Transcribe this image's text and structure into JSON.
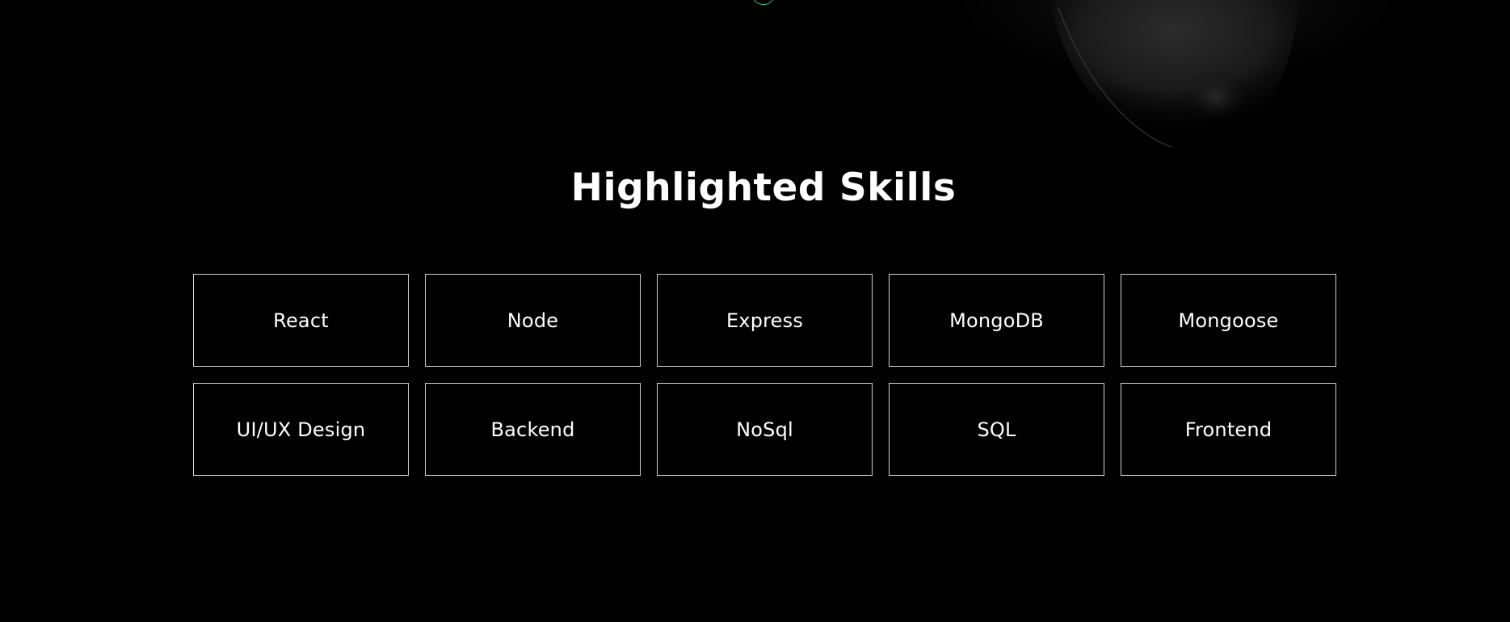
{
  "colors": {
    "background": "#000000",
    "text": "#ffffff",
    "card_border": "#d0d0d0",
    "accent": "#2ecc71"
  },
  "hero": {
    "image_icon": "portrait-photo",
    "scroll_indicator_icon": "scroll-indicator-icon"
  },
  "skills": {
    "title": "Highlighted Skills",
    "items": [
      {
        "label": "React"
      },
      {
        "label": "Node"
      },
      {
        "label": "Express"
      },
      {
        "label": "MongoDB"
      },
      {
        "label": "Mongoose"
      },
      {
        "label": "UI/UX Design"
      },
      {
        "label": "Backend"
      },
      {
        "label": "NoSql"
      },
      {
        "label": "SQL"
      },
      {
        "label": "Frontend"
      }
    ]
  }
}
